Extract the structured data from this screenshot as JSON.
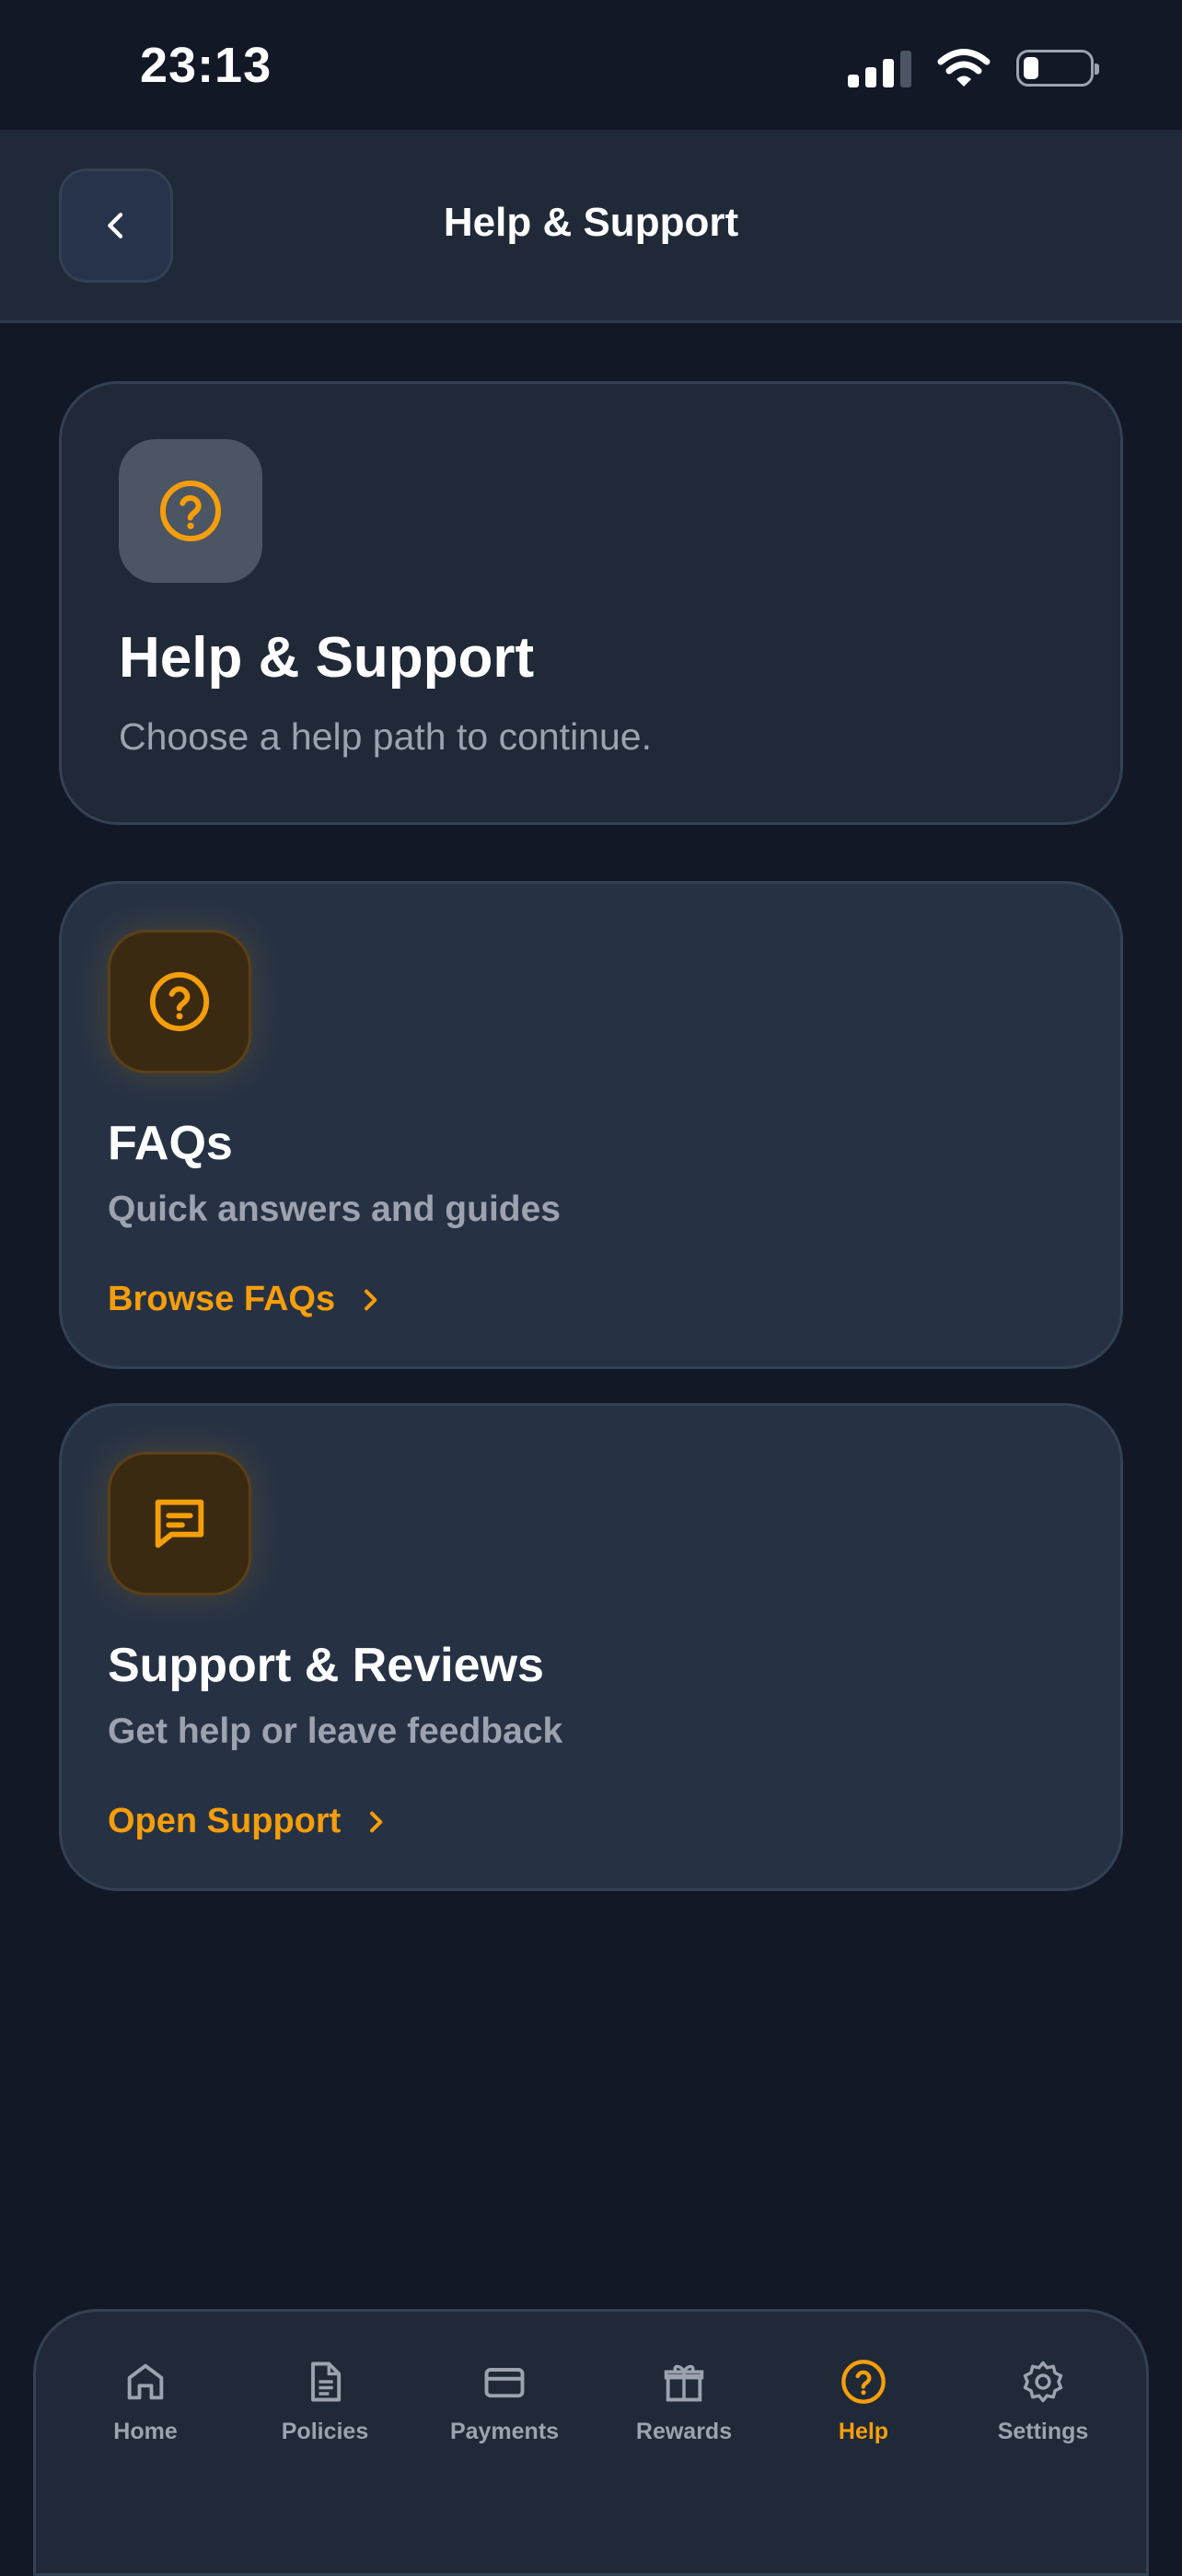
{
  "status_bar": {
    "time": "23:13",
    "battery_level": 0.2
  },
  "header": {
    "title": "Help & Support",
    "back_icon": "chevron-left-icon"
  },
  "hero": {
    "icon": "question-circle-icon",
    "title": "Help & Support",
    "subtitle": "Choose a help path to continue."
  },
  "options": [
    {
      "icon": "question-circle-icon",
      "title": "FAQs",
      "subtitle": "Quick answers and guides",
      "link_label": "Browse FAQs"
    },
    {
      "icon": "chat-bubble-icon",
      "title": "Support & Reviews",
      "subtitle": "Get help or leave feedback",
      "link_label": "Open Support"
    }
  ],
  "nav": {
    "items": [
      {
        "label": "Home",
        "icon": "home-icon"
      },
      {
        "label": "Policies",
        "icon": "document-icon"
      },
      {
        "label": "Payments",
        "icon": "credit-card-icon"
      },
      {
        "label": "Rewards",
        "icon": "gift-icon"
      },
      {
        "label": "Help",
        "icon": "question-circle-icon",
        "active": true
      },
      {
        "label": "Settings",
        "icon": "gear-icon"
      }
    ]
  },
  "colors": {
    "accent": "#f59e0b",
    "background": "#121826",
    "card": "#263244",
    "muted_text": "#9ca3af"
  }
}
